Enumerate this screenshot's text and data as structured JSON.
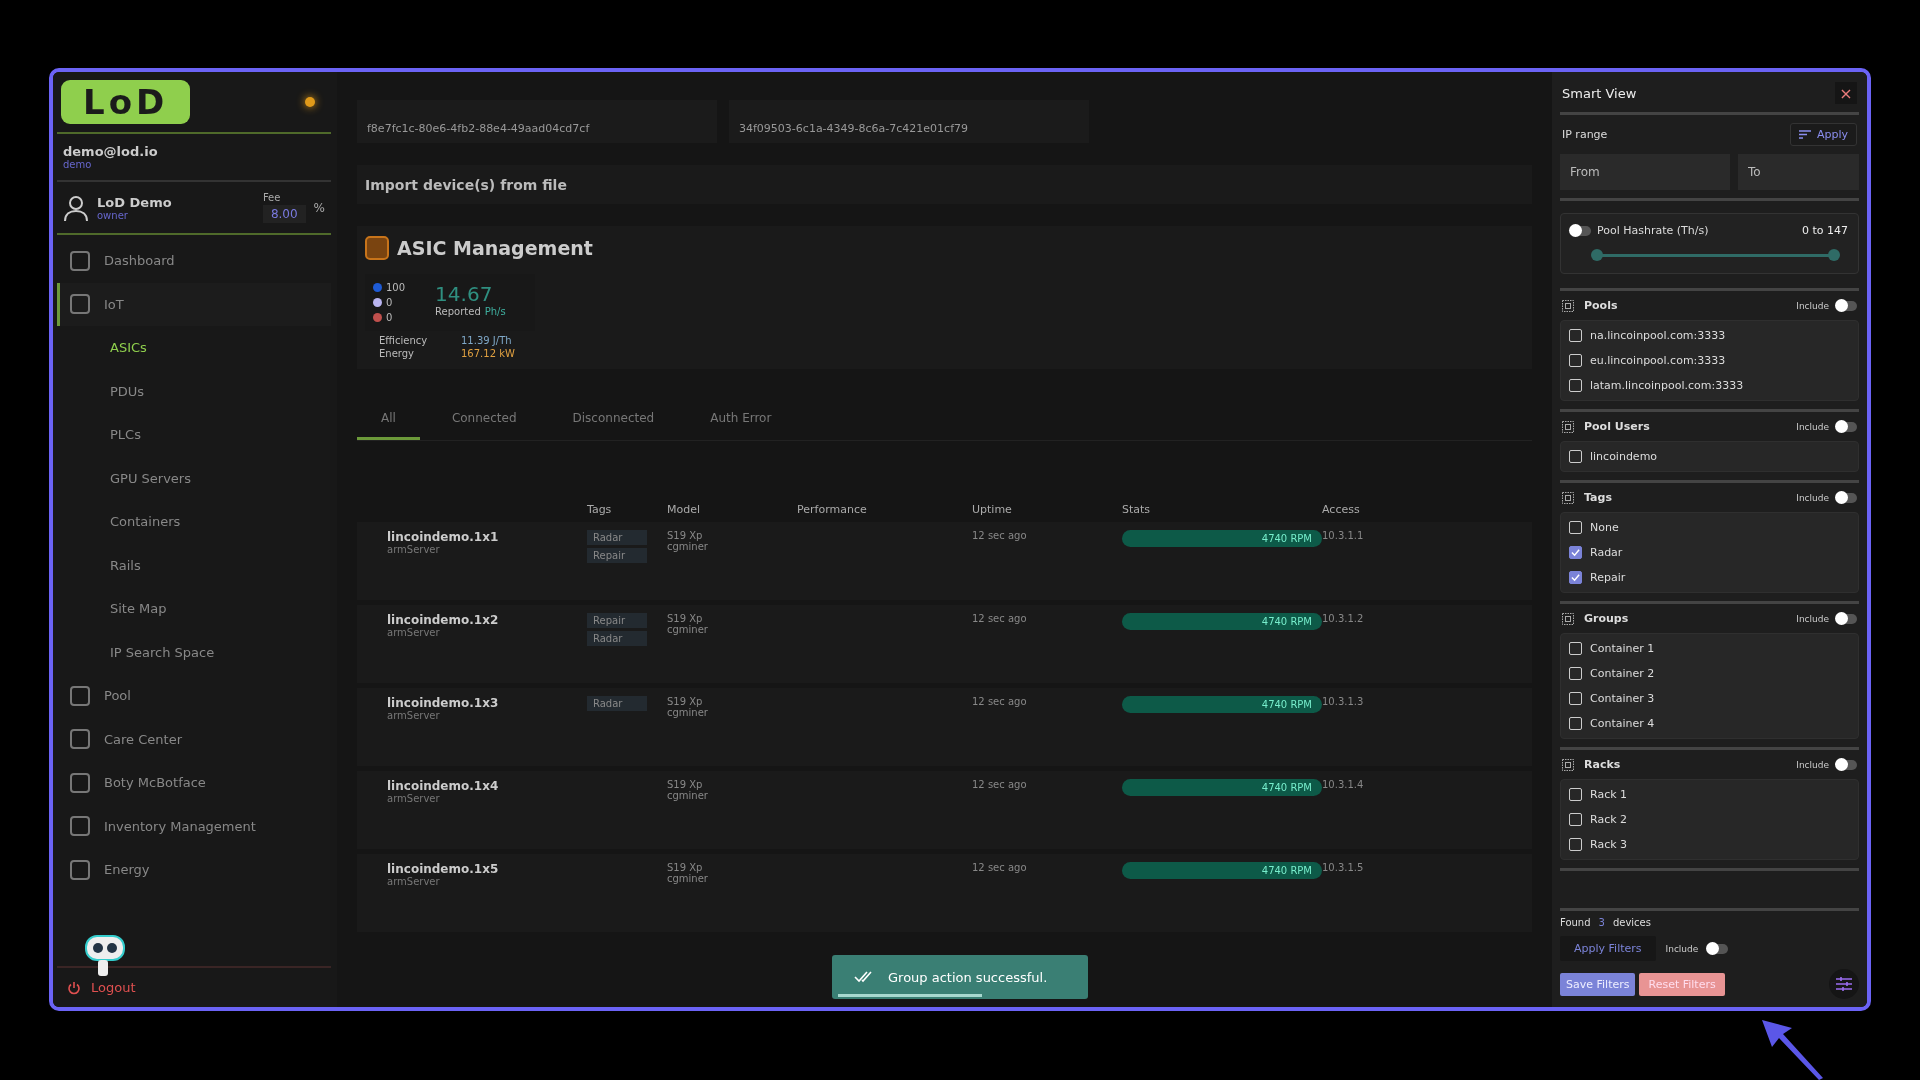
{
  "sidebar": {
    "logo": "LoD",
    "account": {
      "email": "demo@lod.io",
      "role": "demo"
    },
    "user": {
      "name": "LoD Demo",
      "role": "owner",
      "fee_label": "Fee",
      "fee": "8.00",
      "fee_unit": "%"
    },
    "items": [
      {
        "label": "Dashboard",
        "selected": false
      },
      {
        "label": "IoT",
        "selected": false,
        "expanded": true,
        "children": [
          {
            "label": "ASICs",
            "selected": true
          },
          {
            "label": "PDUs",
            "selected": false
          },
          {
            "label": "PLCs",
            "selected": false
          },
          {
            "label": "GPU Servers",
            "selected": false
          },
          {
            "label": "Containers",
            "selected": false
          },
          {
            "label": "Rails",
            "selected": false
          },
          {
            "label": "Site Map",
            "selected": false
          },
          {
            "label": "IP Search Space",
            "selected": false
          }
        ]
      },
      {
        "label": "Pool",
        "selected": false
      },
      {
        "label": "Care Center",
        "selected": false
      },
      {
        "label": "Boty McBotface",
        "selected": false
      },
      {
        "label": "Inventory Management",
        "selected": false
      },
      {
        "label": "Energy",
        "selected": false
      }
    ],
    "logout": "Logout"
  },
  "main": {
    "ids": [
      "f8e7fc1c-80e6-4fb2-88e4-49aad04cd7cf",
      "34f09503-6c1a-4349-8c6a-7c421e01cf79"
    ],
    "import_label": "Import device(s) from file",
    "title": "ASIC Management",
    "summary": {
      "counts": [
        {
          "value": "100",
          "color": "#1e5bd6"
        },
        {
          "value": "0",
          "color": "#b9b4f0"
        },
        {
          "value": "0",
          "color": "#c0504d"
        }
      ],
      "hashrate": "14.67",
      "hashrate_label": "Reported",
      "hashrate_unit": "Ph/s",
      "efficiency_label": "Efficiency",
      "efficiency": "11.39 J/Th",
      "energy_label": "Energy",
      "energy": "167.12 kW"
    },
    "tabs": [
      {
        "label": "All",
        "selected": true
      },
      {
        "label": "Connected",
        "selected": false
      },
      {
        "label": "Disconnected",
        "selected": false
      },
      {
        "label": "Auth Error",
        "selected": false
      }
    ],
    "columns": [
      "Tags",
      "Model",
      "Performance",
      "Uptime",
      "Stats",
      "Access"
    ],
    "rows": [
      {
        "name": "lincoindemo.1x1",
        "server": "armServer",
        "tags": [
          "Radar",
          "Repair"
        ],
        "model": "S19 Xp",
        "miner": "cgminer",
        "uptime": "12 sec ago",
        "rpm": "4740 RPM",
        "ip": "10.3.1.1"
      },
      {
        "name": "lincoindemo.1x2",
        "server": "armServer",
        "tags": [
          "Repair",
          "Radar"
        ],
        "model": "S19 Xp",
        "miner": "cgminer",
        "uptime": "12 sec ago",
        "rpm": "4740 RPM",
        "ip": "10.3.1.2"
      },
      {
        "name": "lincoindemo.1x3",
        "server": "armServer",
        "tags": [
          "Radar"
        ],
        "model": "S19 Xp",
        "miner": "cgminer",
        "uptime": "12 sec ago",
        "rpm": "4740 RPM",
        "ip": "10.3.1.3"
      },
      {
        "name": "lincoindemo.1x4",
        "server": "armServer",
        "tags": [],
        "model": "S19 Xp",
        "miner": "cgminer",
        "uptime": "12 sec ago",
        "rpm": "4740 RPM",
        "ip": "10.3.1.4"
      },
      {
        "name": "lincoindemo.1x5",
        "server": "armServer",
        "tags": [],
        "model": "S19 Xp",
        "miner": "cgminer",
        "uptime": "12 sec ago",
        "rpm": "4740 RPM",
        "ip": "10.3.1.5"
      }
    ]
  },
  "toast": {
    "message": "Group action successful.",
    "level": 0.6
  },
  "smart_view": {
    "title": "Smart View",
    "close": "×",
    "ip_range": {
      "label": "IP range",
      "apply": "Apply",
      "from_placeholder": "From",
      "to_placeholder": "To"
    },
    "hashrate": {
      "label": "Pool Hashrate (Th/s)",
      "on": false,
      "range": "0 to 147",
      "level": 1
    },
    "sections": [
      {
        "title": "Pools",
        "include_label": "Include",
        "include": false,
        "items": [
          {
            "label": "na.lincoinpool.com:3333",
            "checked": false
          },
          {
            "label": "eu.lincoinpool.com:3333",
            "checked": false
          },
          {
            "label": "latam.lincoinpool.com:3333",
            "checked": false
          }
        ]
      },
      {
        "title": "Pool Users",
        "include_label": "Include",
        "include": false,
        "items": [
          {
            "label": "lincoindemo",
            "checked": false
          }
        ]
      },
      {
        "title": "Tags",
        "include_label": "Include",
        "include": false,
        "items": [
          {
            "label": "None",
            "checked": false
          },
          {
            "label": "Radar",
            "checked": true
          },
          {
            "label": "Repair",
            "checked": true
          }
        ]
      },
      {
        "title": "Groups",
        "include_label": "Include",
        "include": false,
        "items": [
          {
            "label": "Container 1",
            "checked": false
          },
          {
            "label": "Container 2",
            "checked": false
          },
          {
            "label": "Container 3",
            "checked": false
          },
          {
            "label": "Container 4",
            "checked": false
          }
        ]
      },
      {
        "title": "Racks",
        "include_label": "Include",
        "include": false,
        "items": [
          {
            "label": "Rack 1",
            "checked": false
          },
          {
            "label": "Rack 2",
            "checked": false
          },
          {
            "label": "Rack 3",
            "checked": false
          }
        ]
      }
    ],
    "found": {
      "prefix": "Found",
      "count": "3",
      "suffix": "devices"
    },
    "apply_filters": "Apply Filters",
    "include_label": "Include",
    "include": false,
    "save": "Save Filters",
    "reset": "Reset Filters"
  }
}
